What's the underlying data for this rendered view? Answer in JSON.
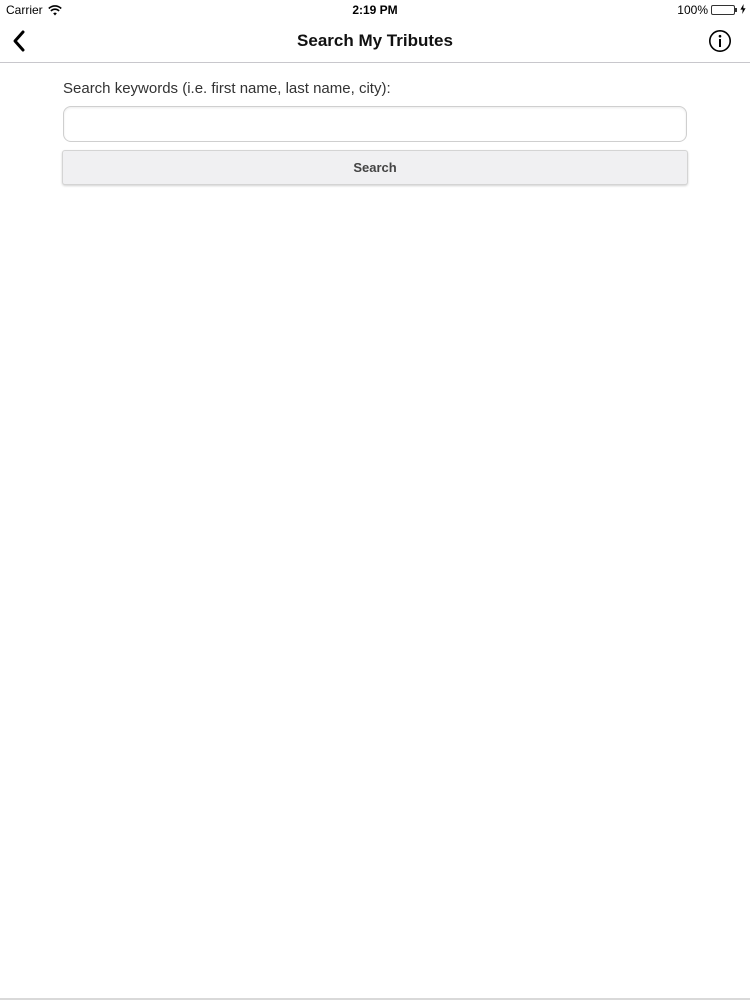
{
  "status_bar": {
    "carrier": "Carrier",
    "time": "2:19 PM",
    "battery": "100%",
    "battery_color": "#4cd964",
    "icons": [
      "wifi-icon",
      "battery-icon",
      "charging-bolt-icon"
    ]
  },
  "nav": {
    "title": "Search My Tributes",
    "back_icon": "chevron-left-icon",
    "info_icon": "info-circle-icon"
  },
  "search": {
    "label": "Search keywords (i.e. first name, last name, city):",
    "input_value": "",
    "placeholder": "",
    "button_label": "Search"
  }
}
